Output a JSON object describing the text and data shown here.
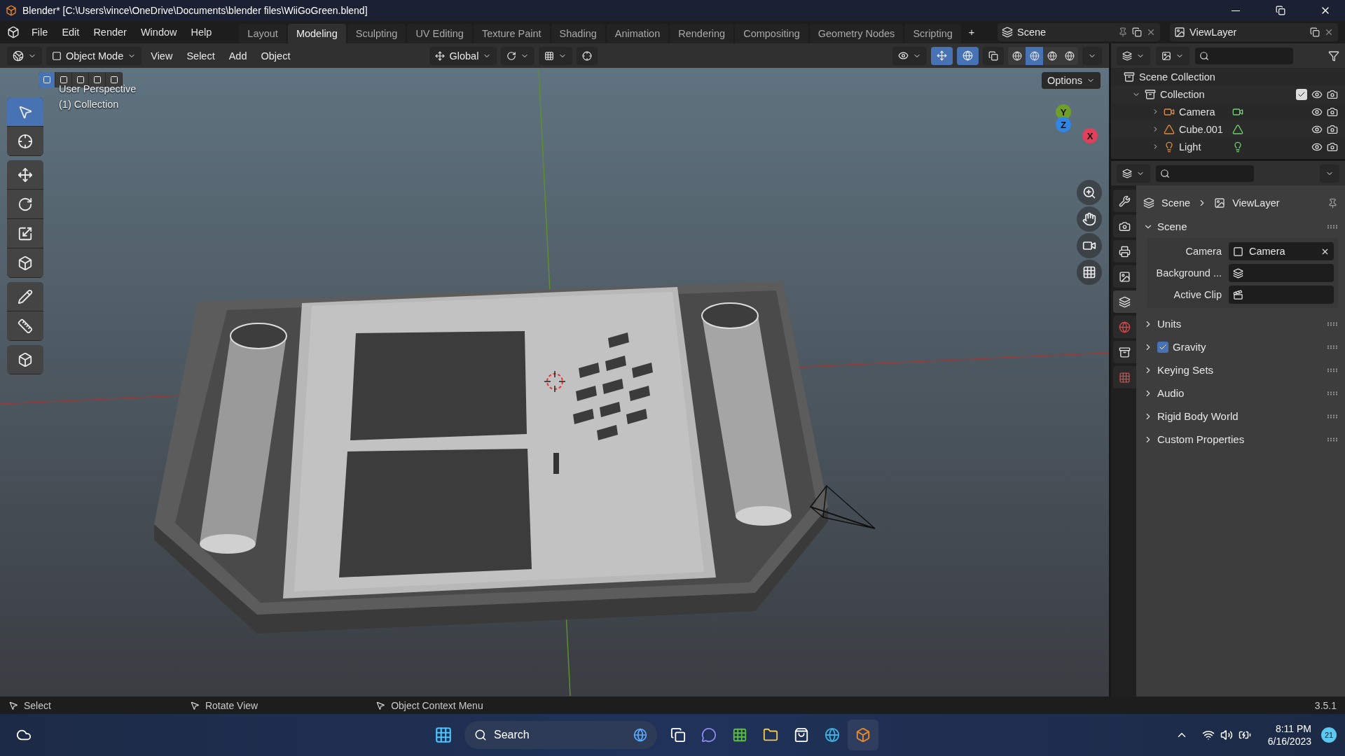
{
  "window": {
    "title": "Blender* [C:\\Users\\vince\\OneDrive\\Documents\\blender files\\WiiGoGreen.blend]"
  },
  "menu": [
    "File",
    "Edit",
    "Render",
    "Window",
    "Help"
  ],
  "workspaces": [
    {
      "label": "Layout",
      "selected": false
    },
    {
      "label": "Modeling",
      "selected": true
    },
    {
      "label": "Sculpting",
      "selected": false
    },
    {
      "label": "UV Editing",
      "selected": false
    },
    {
      "label": "Texture Paint",
      "selected": false
    },
    {
      "label": "Shading",
      "selected": false
    },
    {
      "label": "Animation",
      "selected": false
    },
    {
      "label": "Rendering",
      "selected": false
    },
    {
      "label": "Compositing",
      "selected": false
    },
    {
      "label": "Geometry Nodes",
      "selected": false
    },
    {
      "label": "Scripting",
      "selected": false
    }
  ],
  "add_workspace": "+",
  "scene": "Scene",
  "view_layer": "ViewLayer",
  "viewport": {
    "mode": "Object Mode",
    "menus": [
      "View",
      "Select",
      "Add",
      "Object"
    ],
    "orientation": "Global",
    "gizmos_on": true,
    "overlays_on": true,
    "shading": [
      {
        "selected": false
      },
      {
        "selected": true
      },
      {
        "selected": false
      },
      {
        "selected": false
      }
    ],
    "select_modes": [
      {
        "selected": true
      },
      {
        "selected": false
      },
      {
        "selected": false
      },
      {
        "selected": false
      },
      {
        "selected": false
      }
    ],
    "tools": [
      {
        "kind": "select",
        "selected": true
      },
      {
        "kind": "cursor",
        "selected": false
      },
      {
        "kind": "move",
        "selected": false
      },
      {
        "kind": "rotate",
        "selected": false
      },
      {
        "kind": "scale",
        "selected": false
      },
      {
        "kind": "transform",
        "selected": false
      },
      {
        "kind": "annotate",
        "selected": false
      },
      {
        "kind": "measure",
        "selected": false
      },
      {
        "kind": "add-cube",
        "selected": false
      }
    ],
    "info": [
      "User Perspective",
      "(1) Collection"
    ],
    "options": "Options",
    "axes": [
      {
        "label": "Y",
        "color": "#6f9e2a"
      },
      {
        "label": "Z",
        "color": "#2f86e6"
      },
      {
        "label": "X",
        "color": "#e0405a"
      }
    ]
  },
  "outliner": {
    "root": "Scene Collection",
    "collection": {
      "name": "Collection",
      "checked": true,
      "expanded": true,
      "children": [
        {
          "name": "Camera",
          "kind": "camera"
        },
        {
          "name": "Cube.001",
          "kind": "mesh"
        },
        {
          "name": "Light",
          "kind": "light"
        }
      ]
    }
  },
  "properties": {
    "tabs": [
      {
        "kind": "tool",
        "selected": false
      },
      {
        "kind": "render",
        "selected": false
      },
      {
        "kind": "output",
        "selected": false
      },
      {
        "kind": "view-layer",
        "selected": false
      },
      {
        "kind": "scene",
        "selected": true
      },
      {
        "kind": "world",
        "selected": false
      },
      {
        "kind": "collection",
        "selected": false
      },
      {
        "kind": "texture",
        "selected": false
      }
    ],
    "breadcrumb": [
      "Scene",
      "ViewLayer"
    ],
    "panel": {
      "title": "Scene",
      "expanded": true,
      "fields": [
        {
          "label": "Camera",
          "value": "Camera",
          "kind": "camera"
        },
        {
          "label": "Background ...",
          "kind": "scene"
        },
        {
          "label": "Active Clip",
          "kind": "clip"
        }
      ]
    },
    "sections": [
      {
        "title": "Units",
        "kind": "plain",
        "expanded": false
      },
      {
        "title": "Gravity",
        "kind": "checkbox",
        "checked": true,
        "expanded": false
      },
      {
        "title": "Keying Sets",
        "kind": "plain",
        "expanded": false
      },
      {
        "title": "Audio",
        "kind": "plain",
        "expanded": false
      },
      {
        "title": "Rigid Body World",
        "kind": "plain",
        "expanded": false
      },
      {
        "title": "Custom Properties",
        "kind": "plain",
        "expanded": false
      }
    ]
  },
  "status_bar": {
    "hints": [
      "Select",
      "Rotate View",
      "Object Context Menu"
    ],
    "version": "3.5.1"
  },
  "taskbar": {
    "search": "Search",
    "time": "8:11 PM",
    "date": "6/16/2023",
    "badge": "21"
  }
}
